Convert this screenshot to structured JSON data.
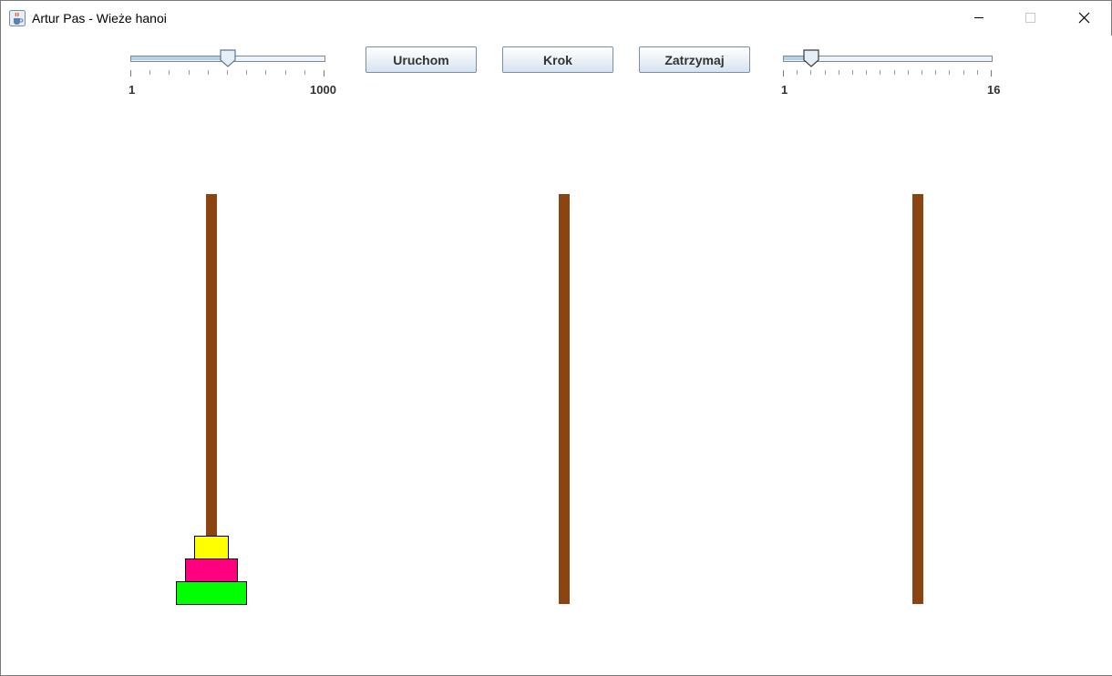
{
  "window": {
    "title": "Artur Pas - Wieże hanoi",
    "icon": "java-cup-icon",
    "controls": [
      "minimize-icon",
      "maximize-icon",
      "close-icon"
    ]
  },
  "toolbar": {
    "speed_slider": {
      "min_label": "1",
      "max_label": "1000",
      "min": 1,
      "max": 1000,
      "value": 500
    },
    "start_label": "Uruchom",
    "step_label": "Krok",
    "stop_label": "Zatrzymaj",
    "disks_slider": {
      "min_label": "1",
      "max_label": "16",
      "min": 1,
      "max": 16,
      "value": 3
    }
  },
  "towers": {
    "peg_color": "#8b4513",
    "pegs": [
      {
        "disks": [
          {
            "size": 3,
            "color": "#00ff00"
          },
          {
            "size": 2,
            "color": "#ff0080"
          },
          {
            "size": 1,
            "color": "#ffff00"
          }
        ]
      },
      {
        "disks": []
      },
      {
        "disks": []
      }
    ]
  }
}
